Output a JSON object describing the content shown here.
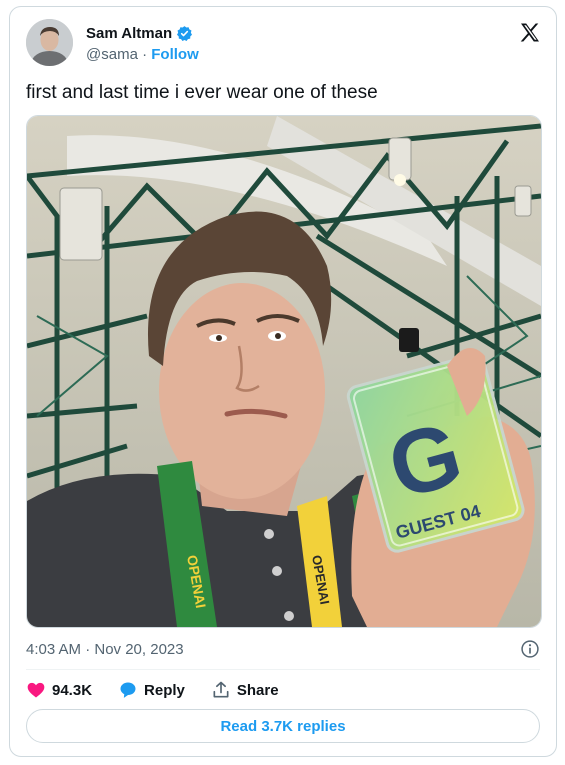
{
  "author": {
    "name": "Sam Altman",
    "handle": "@sama",
    "separator": "·",
    "follow_label": "Follow"
  },
  "tweet": {
    "text": "first and last time i ever wear one of these",
    "timestamp": "4:03 AM · Nov 20, 2023"
  },
  "media": {
    "badge_letter": "G",
    "badge_text": "GUEST 04",
    "lanyard_text": "OPENAI"
  },
  "actions": {
    "likes": "94.3K",
    "reply_label": "Reply",
    "share_label": "Share"
  },
  "footer": {
    "read_replies_label": "Read 3.7K replies"
  },
  "colors": {
    "accent": "#1d9bf0",
    "like": "#f91880",
    "secondary_text": "#536471",
    "border": "#cfd9de"
  }
}
